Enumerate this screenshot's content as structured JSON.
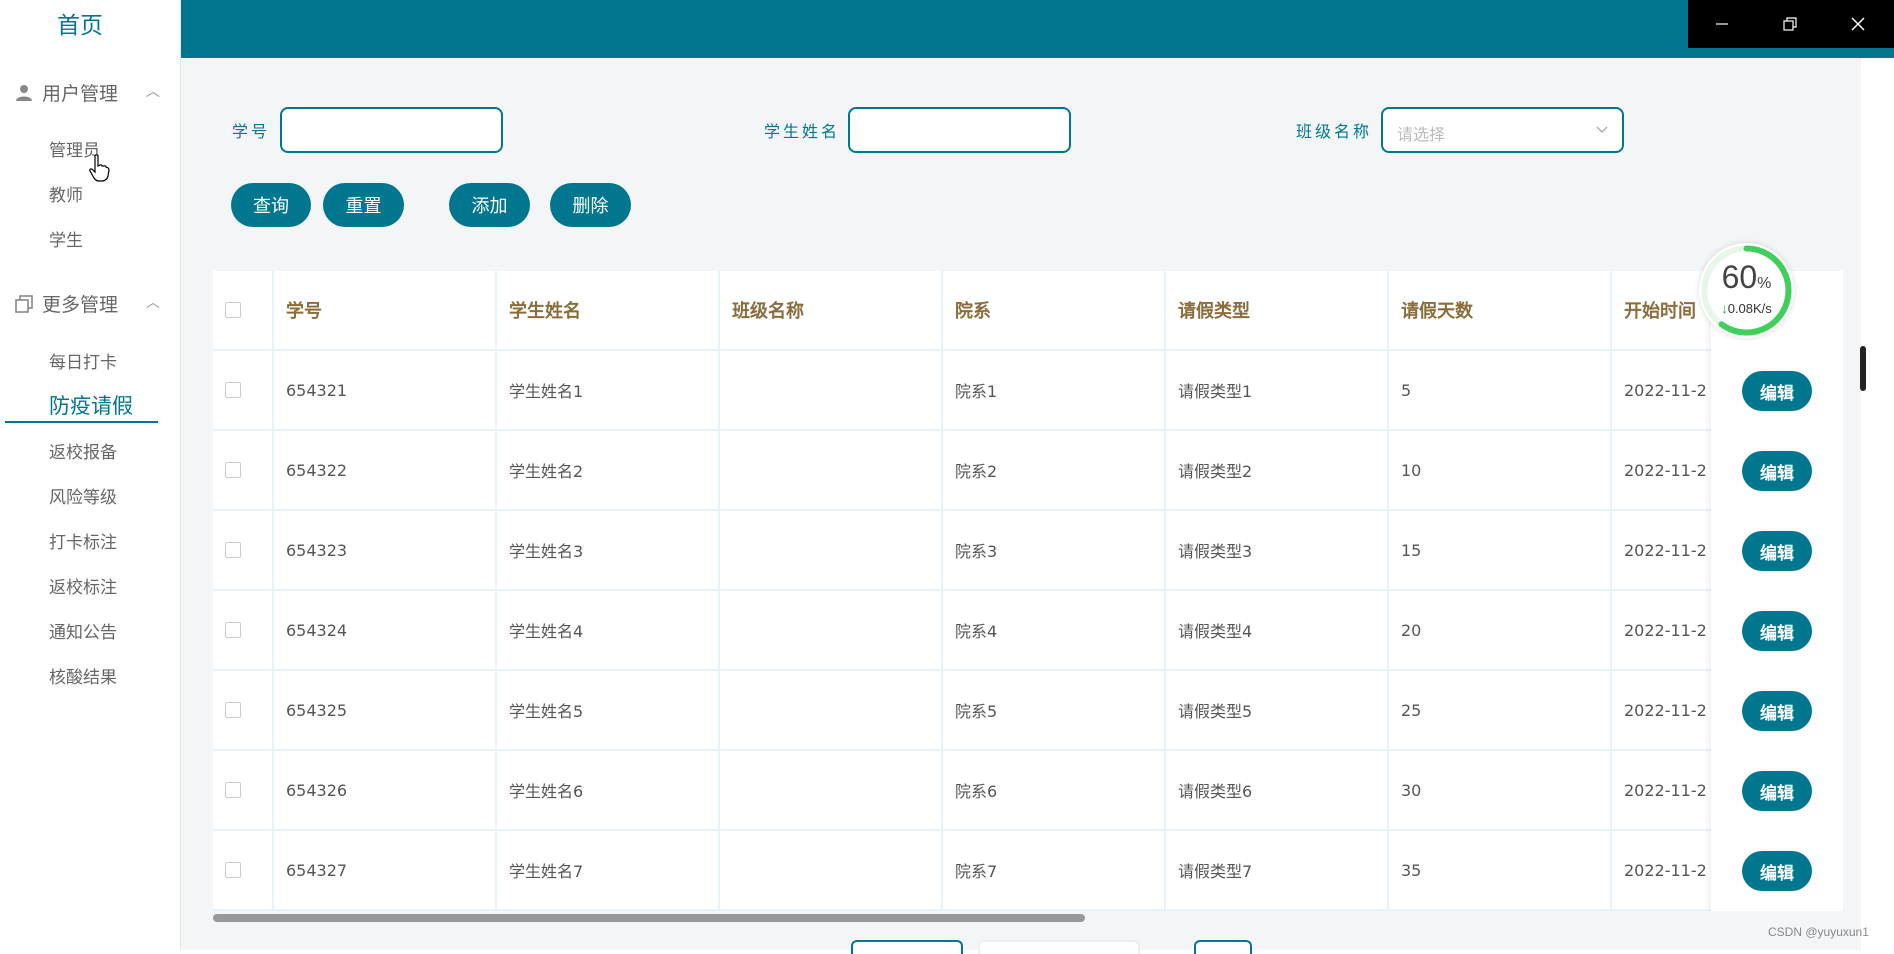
{
  "sidebar": {
    "home": "首页",
    "groups": [
      {
        "label": "用户管理",
        "icon": "user-icon",
        "items": [
          "管理员",
          "教师",
          "学生"
        ]
      },
      {
        "label": "更多管理",
        "icon": "copy-icon",
        "items": [
          "每日打卡",
          "防疫请假",
          "返校报备",
          "风险等级",
          "打卡标注",
          "返校标注",
          "通知公告",
          "核酸结果"
        ]
      }
    ],
    "active_item": "防疫请假"
  },
  "search": {
    "student_no_label": "学号",
    "student_no_value": "",
    "student_name_label": "学生姓名",
    "student_name_value": "",
    "class_label": "班级名称",
    "class_placeholder": "请选择"
  },
  "actions": {
    "query": "查询",
    "reset": "重置",
    "add": "添加",
    "delete": "删除"
  },
  "table": {
    "columns": [
      "学号",
      "学生姓名",
      "班级名称",
      "院系",
      "请假类型",
      "请假天数",
      "开始时间"
    ],
    "rows": [
      [
        "654321",
        "学生姓名1",
        "",
        "院系1",
        "请假类型1",
        "5",
        "2022-11-2"
      ],
      [
        "654322",
        "学生姓名2",
        "",
        "院系2",
        "请假类型2",
        "10",
        "2022-11-2"
      ],
      [
        "654323",
        "学生姓名3",
        "",
        "院系3",
        "请假类型3",
        "15",
        "2022-11-2"
      ],
      [
        "654324",
        "学生姓名4",
        "",
        "院系4",
        "请假类型4",
        "20",
        "2022-11-2"
      ],
      [
        "654325",
        "学生姓名5",
        "",
        "院系5",
        "请假类型5",
        "25",
        "2022-11-2"
      ],
      [
        "654326",
        "学生姓名6",
        "",
        "院系6",
        "请假类型6",
        "30",
        "2022-11-2"
      ],
      [
        "654327",
        "学生姓名7",
        "",
        "院系7",
        "请假类型7",
        "35",
        "2022-11-2"
      ]
    ],
    "edit_label": "编辑"
  },
  "speed_widget": {
    "percent": "60",
    "percent_sign": "%",
    "speed": "0.08K/s",
    "arrow": "↓"
  },
  "watermark": "CSDN @yuyuxun1",
  "colors": {
    "accent": "#00778e",
    "header_text": "#8a6d3b",
    "background": "#f4f5f7"
  }
}
